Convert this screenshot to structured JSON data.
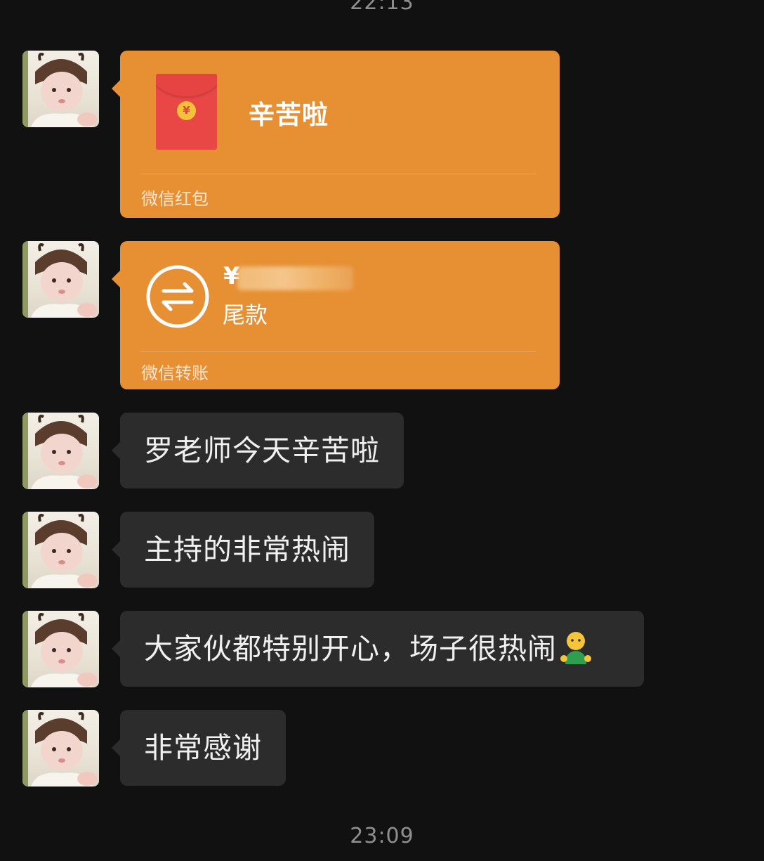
{
  "chat": {
    "timestamp_top": "22:13",
    "timestamp_bottom": "23:09",
    "red_packet": {
      "title": "辛苦啦",
      "footer": "微信红包",
      "icon": "red-envelope-icon",
      "coin_symbol": "¥"
    },
    "transfer": {
      "currency_symbol": "¥",
      "amount_obscured": true,
      "note": "尾款",
      "footer": "微信转账",
      "icon": "transfer-arrows-icon"
    },
    "messages": [
      {
        "text": "罗老师今天辛苦啦"
      },
      {
        "text": "主持的非常热闹"
      },
      {
        "text": "大家伙都特别开心，场子很热闹",
        "emoji": "person-emoji"
      },
      {
        "text": "非常感谢"
      }
    ],
    "colors": {
      "background": "#111111",
      "orange_card": "#e68f33",
      "gray_bubble": "#2c2c2c",
      "red_envelope": "#e84746"
    }
  }
}
